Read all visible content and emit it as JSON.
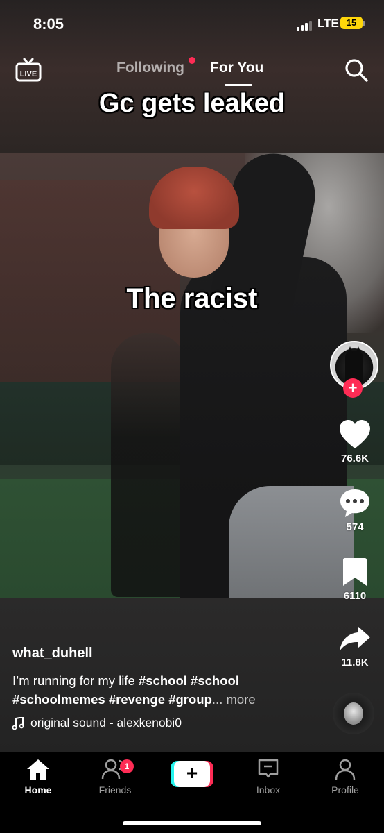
{
  "status_bar": {
    "time": "8:05",
    "network": "LTE",
    "battery": "15"
  },
  "top_nav": {
    "live_label": "LIVE",
    "tabs": [
      {
        "label": "Following"
      },
      {
        "label": "For You"
      }
    ],
    "active_tab": "For You"
  },
  "video": {
    "overlay_title": "Gc gets leaked",
    "overlay_subtitle": "The racist"
  },
  "actions": {
    "likes": "76.6K",
    "comments": "574",
    "saves": "6110",
    "shares": "11.8K"
  },
  "post": {
    "username": "what_duhell",
    "caption_prefix": "I’m running for my life ",
    "hashtags": [
      "#school",
      "#school",
      "#schoolmemes",
      "#revenge",
      "#group"
    ],
    "more_label": "... more",
    "sound": "original sound - alexkenobi0"
  },
  "tabbar": {
    "items": [
      {
        "label": "Home"
      },
      {
        "label": "Friends",
        "badge": "1"
      },
      {
        "label": "+"
      },
      {
        "label": "Inbox"
      },
      {
        "label": "Profile"
      }
    ]
  },
  "colors": {
    "accent": "#fe2c55",
    "cyan": "#25f4ee",
    "battery": "#ffd60a"
  },
  "icons": [
    "live-tv-icon",
    "search-icon",
    "heart-icon",
    "comment-icon",
    "bookmark-icon",
    "share-icon",
    "music-note-icon",
    "home-icon",
    "friends-icon",
    "inbox-icon",
    "profile-icon"
  ]
}
